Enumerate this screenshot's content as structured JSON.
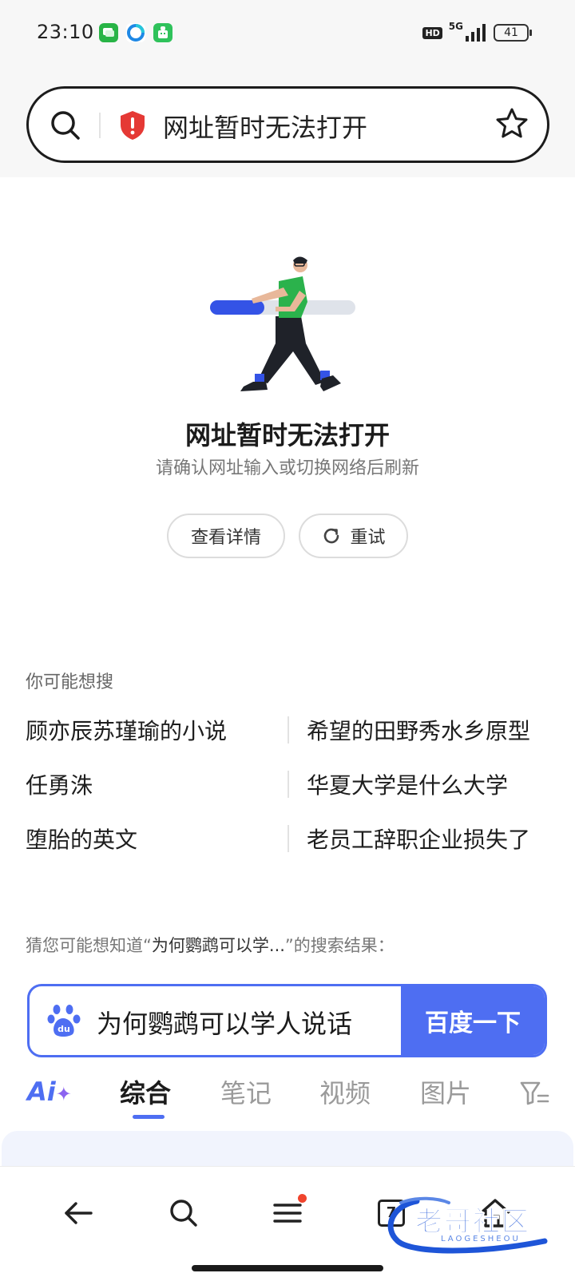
{
  "status_bar": {
    "time": "23:10",
    "network": "5G",
    "battery": "41",
    "hd_label": "HD",
    "icons": [
      "messages-app-icon",
      "browser-app-icon",
      "android-app-icon",
      "signal-icon",
      "battery-icon"
    ]
  },
  "address_bar": {
    "text": "网址暂时无法打开",
    "icons": [
      "search-icon",
      "security-warning-icon",
      "bookmark-star-icon"
    ],
    "warning_color": "#e53935"
  },
  "error_page": {
    "title": "网址暂时无法打开",
    "subtitle": "请确认网址输入或切换网络后刷新",
    "details_button": "查看详情",
    "retry_button": "重试"
  },
  "suggestions": {
    "heading": "你可能想搜",
    "left": [
      "顾亦辰苏瑾瑜的小说",
      "任勇洙",
      "堕胎的英文"
    ],
    "right": [
      "希望的田野秀水乡原型",
      "华夏大学是什么大学",
      "老员工辞职企业损失了"
    ]
  },
  "guess": {
    "prefix": "猜您可能想知道“",
    "query": "为何鹦鹉可以学...",
    "suffix": "”的搜索结果："
  },
  "baidu": {
    "query": "为何鹦鹉可以学人说话",
    "button": "百度一下",
    "accent": "#4e6ef2"
  },
  "result_tabs": {
    "ai_label": "Ai",
    "tabs": [
      "综合",
      "笔记",
      "视频",
      "图片"
    ],
    "active": "综合"
  },
  "bottom_nav": {
    "items": [
      "back-arrow-icon",
      "search-icon",
      "menu-icon",
      "tabs-icon",
      "home-icon"
    ],
    "tab_count": "7"
  },
  "watermark": {
    "text": "老哥社区",
    "sub": "LAOGESHEOU"
  }
}
